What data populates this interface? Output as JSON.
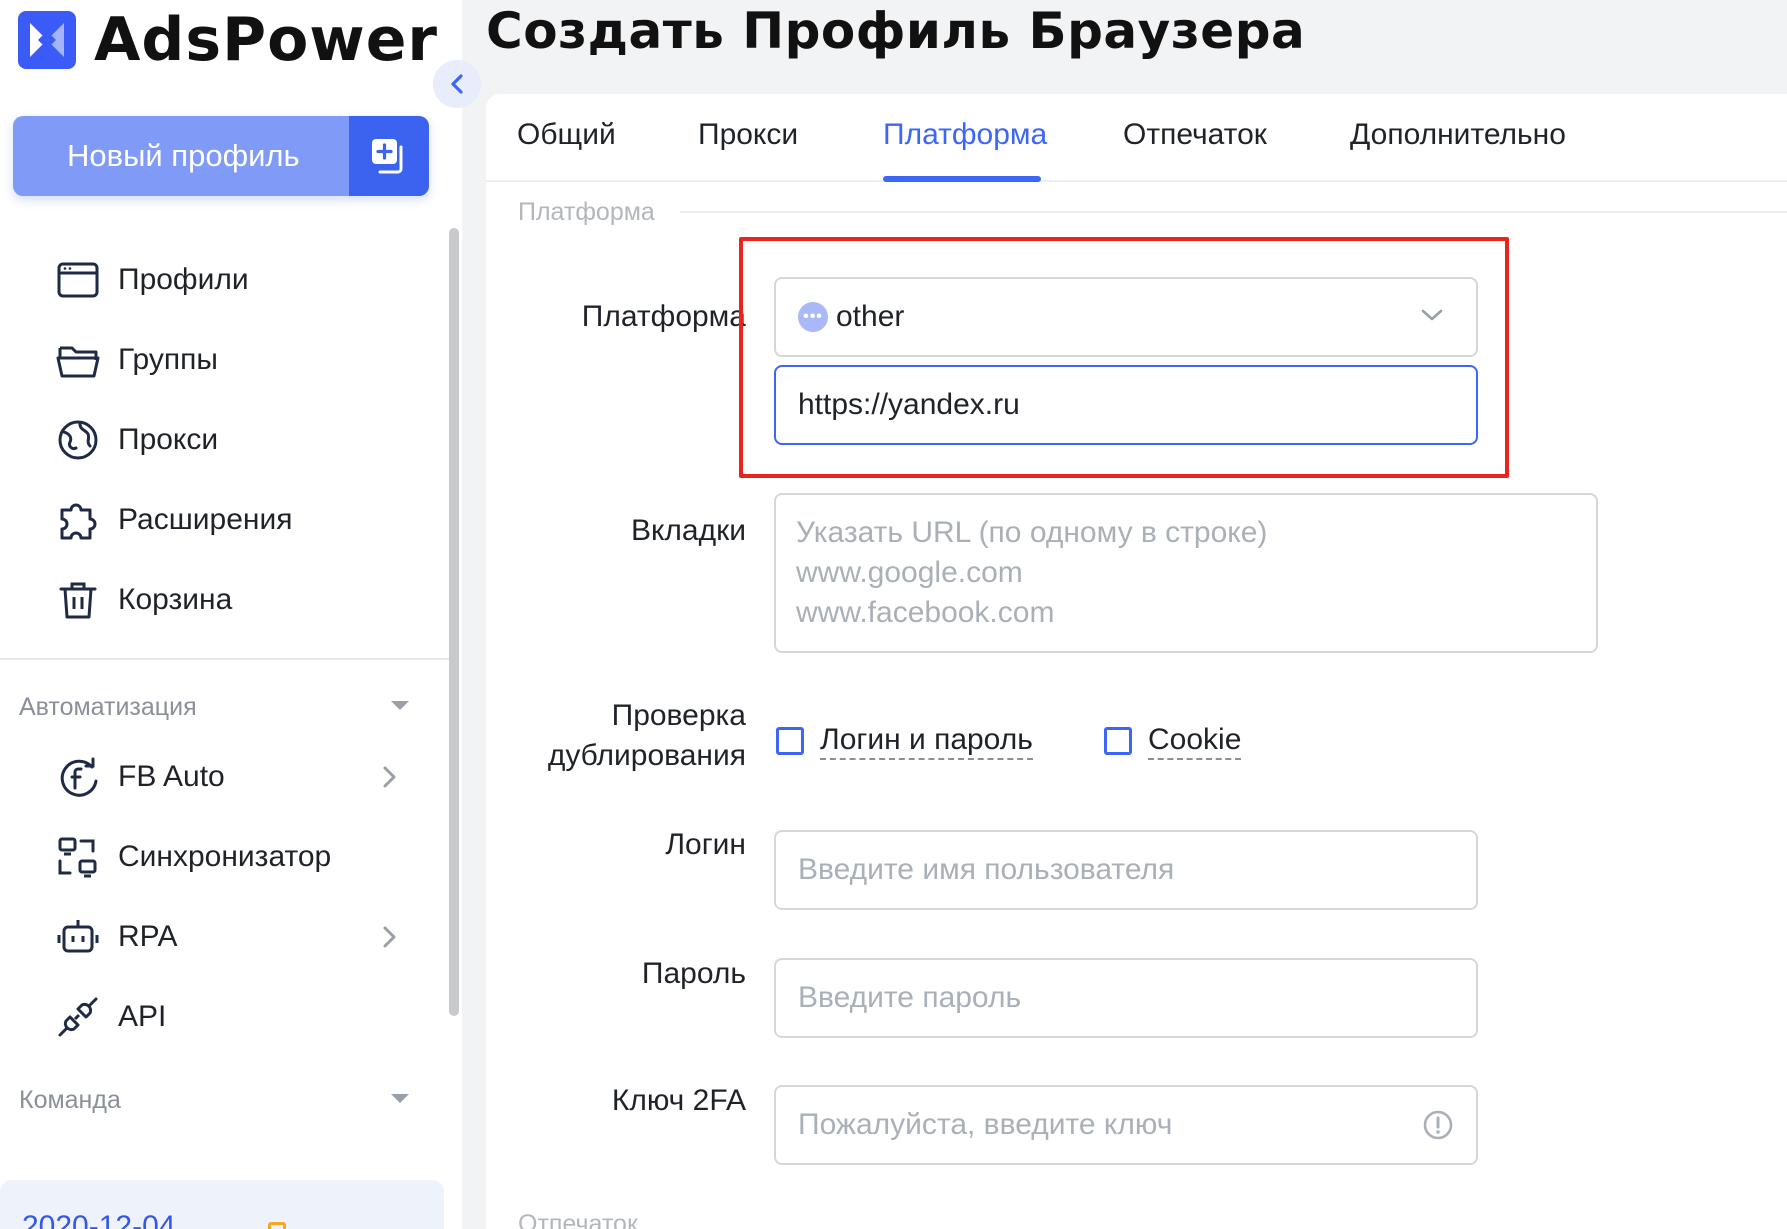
{
  "app": {
    "brand": "AdsPower",
    "page_title": "Создать Профиль Браузера"
  },
  "sidebar": {
    "new_profile_label": "Новый профиль",
    "nav": [
      {
        "label": "Профили",
        "icon": "browser-window-icon"
      },
      {
        "label": "Группы",
        "icon": "folder-icon"
      },
      {
        "label": "Прокси",
        "icon": "globe-icon"
      },
      {
        "label": "Расширения",
        "icon": "puzzle-icon"
      },
      {
        "label": "Корзина",
        "icon": "trash-icon"
      }
    ],
    "automation_label": "Автоматизация",
    "automation": [
      {
        "label": "FB Auto",
        "icon": "facebook-sync-icon"
      },
      {
        "label": "Синхронизатор",
        "icon": "synchronizer-icon"
      },
      {
        "label": "RPA",
        "icon": "robot-icon"
      },
      {
        "label": "API",
        "icon": "plug-icon"
      }
    ],
    "team_label": "Команда",
    "date_partial": "2020-12-04"
  },
  "tabs": [
    {
      "label": "Общий",
      "active": false
    },
    {
      "label": "Прокси",
      "active": false
    },
    {
      "label": "Платформа",
      "active": true
    },
    {
      "label": "Отпечаток",
      "active": false
    },
    {
      "label": "Дополнительно",
      "active": false
    }
  ],
  "form": {
    "section_label": "Платформа",
    "platform_label": "Платформа",
    "platform_value": "other",
    "platform_url": "https://yandex.ru",
    "tabs_label": "Вкладки",
    "tabs_placeholder": [
      "Указать URL (по одному в строке)",
      "www.google.com",
      "www.facebook.com"
    ],
    "dup_label_line1": "Проверка",
    "dup_label_line2": "дублирования",
    "dup_options": [
      "Логин и пароль",
      "Cookie"
    ],
    "login_label": "Логин",
    "login_placeholder": "Введите имя пользователя",
    "password_label": "Пароль",
    "password_placeholder": "Введите пароль",
    "twofa_label": "Ключ 2FA",
    "twofa_placeholder": "Пожалуйста, введите ключ",
    "next_section_partial": "Отпечаток"
  },
  "colors": {
    "accent": "#3d66f5",
    "highlight_box": "#e8241c",
    "new_profile_bg": "#7f9bf7"
  }
}
